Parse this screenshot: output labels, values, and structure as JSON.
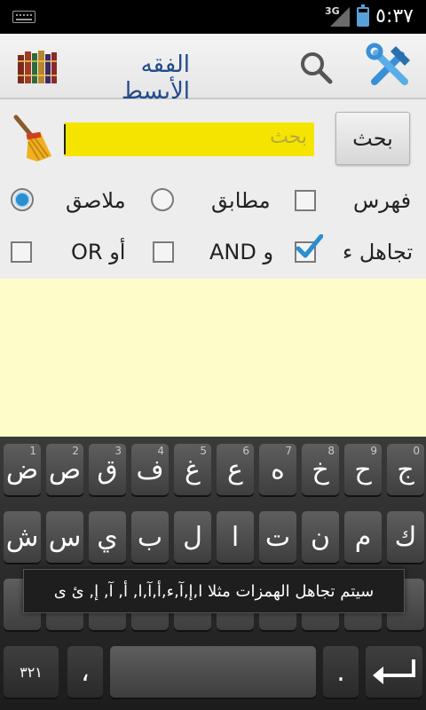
{
  "status_bar": {
    "network": "3G",
    "time": "٥:٣٧"
  },
  "action_bar": {
    "title": "الفقه الأبسط",
    "icons": [
      "books-icon",
      "search-icon",
      "tools-icon"
    ]
  },
  "search": {
    "placeholder": "بحث",
    "value": "",
    "button_label": "بحث"
  },
  "options": {
    "index_label": "فهرس",
    "exact_label": "مطابق",
    "adjacent_label": "ملاصق",
    "ignore_hamza_label": "تجاهل ء",
    "and_label": "و AND",
    "or_label": "أو OR",
    "index_checked": false,
    "exact_selected": false,
    "adjacent_selected": true,
    "ignore_hamza_checked": true,
    "and_checked": false,
    "or_checked": false
  },
  "colors": {
    "search_field": "#f5e400",
    "results_bg": "#fefcc9",
    "title": "#234a8a",
    "accent": "#2a8fd1"
  },
  "keyboard": {
    "row1": [
      {
        "label": "ج",
        "hint": "0"
      },
      {
        "label": "ح",
        "hint": "9"
      },
      {
        "label": "خ",
        "hint": "8"
      },
      {
        "label": "ه",
        "hint": "7"
      },
      {
        "label": "ع",
        "hint": "6"
      },
      {
        "label": "غ",
        "hint": "5"
      },
      {
        "label": "ف",
        "hint": "4"
      },
      {
        "label": "ق",
        "hint": "3"
      },
      {
        "label": "ص",
        "hint": "2"
      },
      {
        "label": "ض",
        "hint": "1"
      }
    ],
    "row2": [
      "ك",
      "م",
      "ن",
      "ت",
      "ا",
      "ل",
      "ب",
      "ي",
      "س",
      "ش"
    ],
    "row4": {
      "numbers_key": "٣٢١",
      "comma_key": "،",
      "period_key": "."
    }
  },
  "toast": "سيتم تجاهل الهمزات مثلا ا,إ,آ,ء,أ,آ,ا, أ, آ, إ, ئ ى"
}
